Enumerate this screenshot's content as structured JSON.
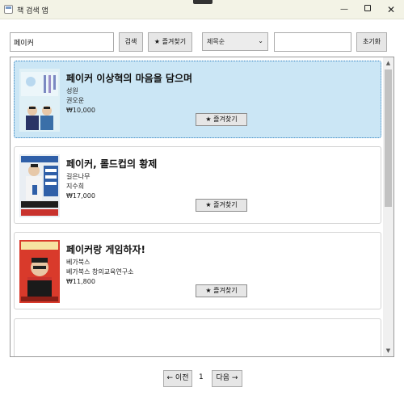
{
  "window": {
    "title": "책 검색 앱",
    "close_glyph": "✕",
    "minimize_glyph": "—",
    "maximize_icon": "square-icon"
  },
  "search": {
    "value": "페이커",
    "button": "검색",
    "favorites_button": "★ 즐겨찾기"
  },
  "sort": {
    "selected": "제목순",
    "chevron": "⌄"
  },
  "filter": {
    "value": ""
  },
  "reset_button": "초기화",
  "books": [
    {
      "title": "페이커 이상혁의 마음을 담으며",
      "lines": [
        "성원",
        "권오운",
        "₩10,000"
      ],
      "favorite": "★ 즐겨찾기",
      "selected": true
    },
    {
      "title": "페이커, 롤드컵의 황제",
      "lines": [
        "길은나무",
        "지수희",
        "₩17,000"
      ],
      "favorite": "★ 즐겨찾기",
      "selected": false
    },
    {
      "title": "페이커랑 게임하자!",
      "lines": [
        "베가북스",
        "베가북스 창의교육연구소",
        "₩11,800"
      ],
      "favorite": "★ 즐겨찾기",
      "selected": false
    }
  ],
  "scroll": {
    "up": "▲",
    "down": "▼"
  },
  "pager": {
    "prev": "← 이전",
    "page": "1",
    "next": "다음 →"
  },
  "colors": {
    "selected_bg": "#cbe6f5",
    "selected_border": "#2f80c0",
    "titlebar_bg": "#f3f3e6"
  }
}
